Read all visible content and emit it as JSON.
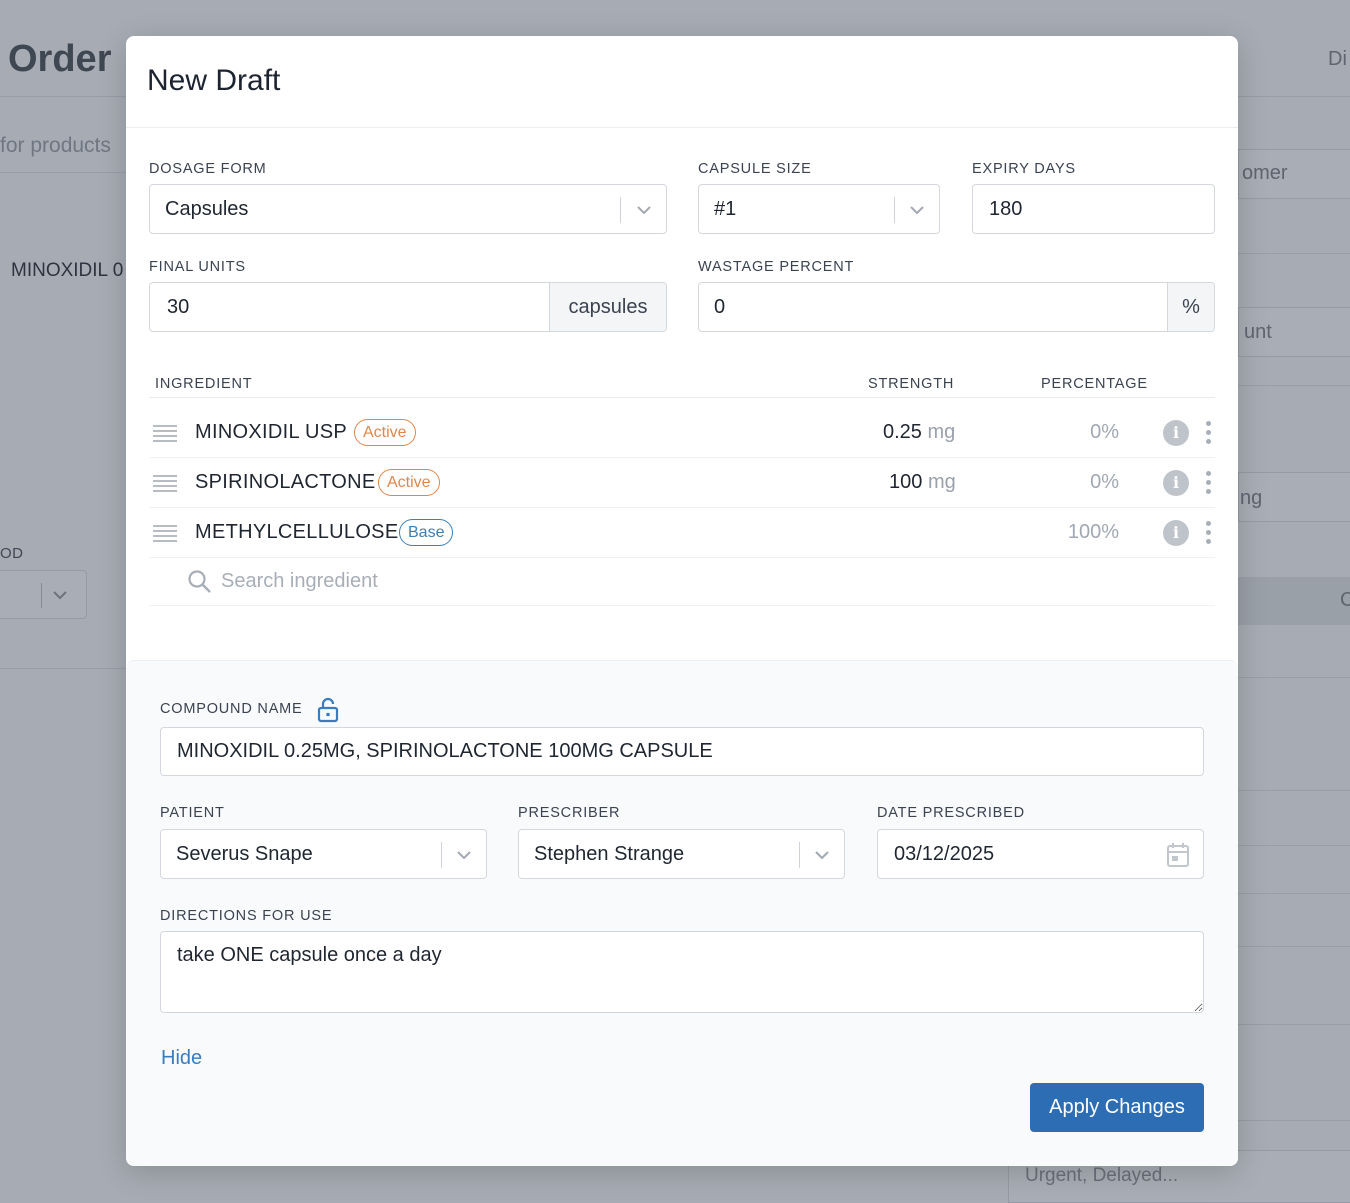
{
  "background": {
    "title": "Order",
    "search_placeholder": "for products",
    "product_text": "MINOXIDIL 0",
    "field_label": "OD",
    "right_texts": [
      "Di",
      "omer",
      "unt",
      "ng",
      "C"
    ],
    "urgent_placeholder": "Urgent, Delayed..."
  },
  "modal": {
    "title": "New Draft",
    "dosage_form": {
      "label": "DOSAGE FORM",
      "value": "Capsules"
    },
    "capsule_size": {
      "label": "CAPSULE SIZE",
      "value": "#1"
    },
    "expiry_days": {
      "label": "EXPIRY DAYS",
      "value": "180"
    },
    "final_units": {
      "label": "FINAL UNITS",
      "value": "30",
      "addon": "capsules"
    },
    "wastage": {
      "label": "WASTAGE PERCENT",
      "value": "0",
      "addon": "%"
    },
    "table": {
      "headers": {
        "ingredient": "INGREDIENT",
        "strength": "STRENGTH",
        "percentage": "PERCENTAGE"
      },
      "rows": [
        {
          "name": "MINOXIDIL USP",
          "badge": "Active",
          "strength": "0.25",
          "unit": "mg",
          "percentage": "0%"
        },
        {
          "name": "SPIRINOLACTONE",
          "badge": "Active",
          "strength": "100",
          "unit": "mg",
          "percentage": "0%"
        },
        {
          "name": "METHYLCELLULOSE",
          "badge": "Base",
          "strength": "",
          "unit": "",
          "percentage": "100%"
        }
      ],
      "search_placeholder": "Search ingredient",
      "info_glyph": "i"
    },
    "compound_name": {
      "label": "COMPOUND NAME",
      "value": "MINOXIDIL 0.25MG, SPIRINOLACTONE 100MG  CAPSULE"
    },
    "patient": {
      "label": "PATIENT",
      "value": "Severus Snape"
    },
    "prescriber": {
      "label": "PRESCRIBER",
      "value": "Stephen Strange"
    },
    "date_prescribed": {
      "label": "DATE PRESCRIBED",
      "value": "03/12/2025"
    },
    "directions": {
      "label": "DIRECTIONS FOR USE",
      "value": "take ONE capsule once a day"
    },
    "hide_label": "Hide",
    "apply_label": "Apply Changes"
  },
  "colors": {
    "primary": "#2c6db4",
    "active_badge": "#e0864d",
    "base_badge": "#3c7fb8"
  }
}
